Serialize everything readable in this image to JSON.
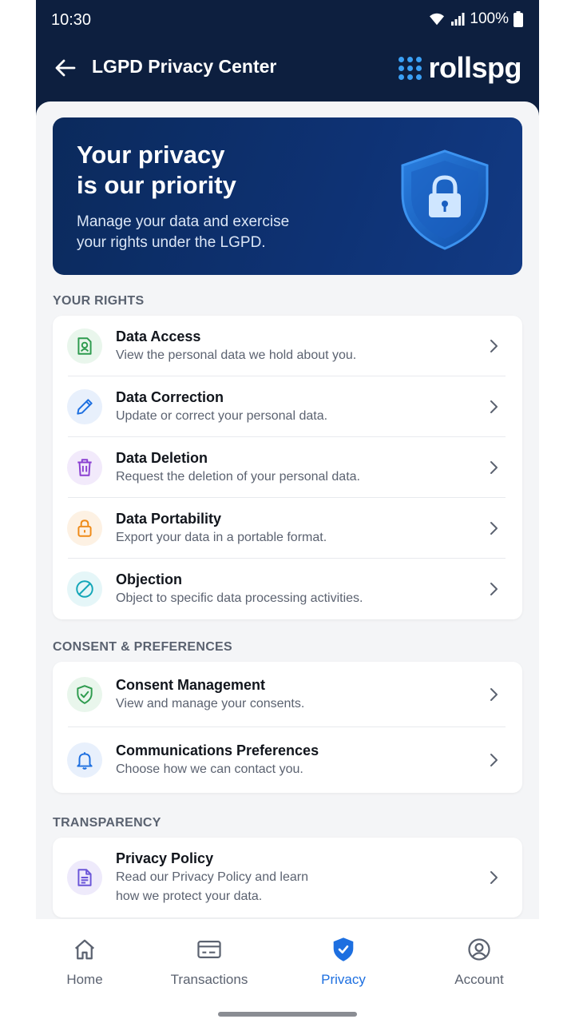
{
  "status_bar": {
    "time": "10:30",
    "battery": "100%"
  },
  "header": {
    "title": "LGPD Privacy Center",
    "logo_text": "rollspg"
  },
  "hero": {
    "title": "Your privacy\nis our priority",
    "subtitle": "Manage your data and exercise\nyour rights under the LGPD."
  },
  "sections": {
    "rights": {
      "label": "YOUR RIGHTS",
      "items": [
        {
          "title": "Data Access",
          "description": "View the personal data we hold about you.",
          "icon": "user-document-icon",
          "color": "#2e9b4e",
          "bg": "#e9f6ec"
        },
        {
          "title": "Data Correction",
          "description": "Update or correct your personal data.",
          "icon": "pencil-icon",
          "color": "#1d6fe0",
          "bg": "#e8f0fc"
        },
        {
          "title": "Data Deletion",
          "description": "Request the deletion of your personal data.",
          "icon": "trash-icon",
          "color": "#8a3fd1",
          "bg": "#f2eafb"
        },
        {
          "title": "Data Portability",
          "description": "Export your data in a portable format.",
          "icon": "lock-icon",
          "color": "#ef8a17",
          "bg": "#fdf1e3"
        },
        {
          "title": "Objection",
          "description": "Object to specific data processing activities.",
          "icon": "block-icon",
          "color": "#13a6b8",
          "bg": "#e5f6f8"
        }
      ]
    },
    "consent": {
      "label": "CONSENT & PREFERENCES",
      "items": [
        {
          "title": "Consent Management",
          "description": "View and manage your consents.",
          "icon": "shield-check-icon",
          "color": "#2e9b4e",
          "bg": "#e9f6ec"
        },
        {
          "title": "Communications Preferences",
          "description": "Choose how we can contact you.",
          "icon": "bell-icon",
          "color": "#1d6fe0",
          "bg": "#e8f0fc"
        }
      ]
    },
    "transparency": {
      "label": "TRANSPARENCY",
      "items": [
        {
          "title": "Privacy Policy",
          "description": "Read our Privacy Policy and learn\nhow we protect your data.",
          "icon": "document-icon",
          "color": "#6a55d8",
          "bg": "#eeeafb"
        }
      ]
    }
  },
  "bottom_nav": {
    "items": [
      {
        "label": "Home",
        "icon": "home-icon"
      },
      {
        "label": "Transactions",
        "icon": "card-icon"
      },
      {
        "label": "Privacy",
        "icon": "shield-icon",
        "active": true
      },
      {
        "label": "Account",
        "icon": "user-circle-icon"
      }
    ]
  },
  "colors": {
    "header_bg": "#0d1f3f",
    "accent": "#1d6fe0"
  }
}
